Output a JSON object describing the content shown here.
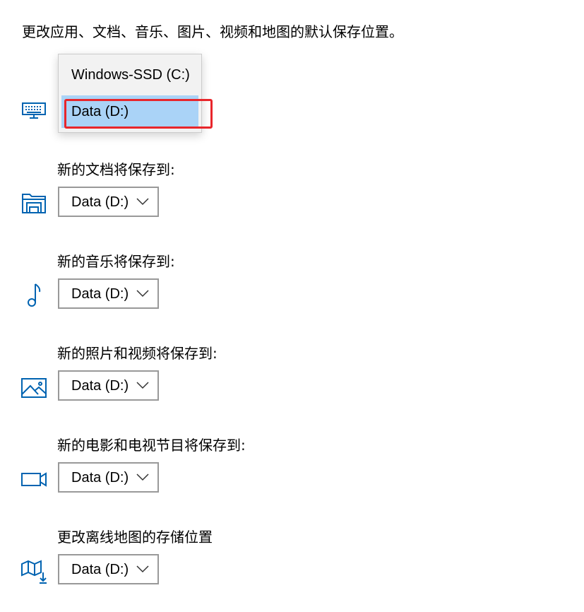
{
  "heading": "更改应用、文档、音乐、图片、视频和地图的默认保存位置。",
  "apps": {
    "icon": "keyboard-monitor-icon",
    "dropdown_options": [
      "Windows-SSD (C:)",
      "Data (D:)"
    ],
    "selected": "Data (D:)"
  },
  "documents": {
    "label": "新的文档将保存到:",
    "icon": "folder-drive-icon",
    "value": "Data (D:)"
  },
  "music": {
    "label": "新的音乐将保存到:",
    "icon": "music-note-icon",
    "value": "Data (D:)"
  },
  "photos": {
    "label": "新的照片和视频将保存到:",
    "icon": "picture-icon",
    "value": "Data (D:)"
  },
  "movies": {
    "label": "新的电影和电视节目将保存到:",
    "icon": "video-camera-icon",
    "value": "Data (D:)"
  },
  "maps": {
    "label": "更改离线地图的存储位置",
    "icon": "map-download-icon",
    "value": "Data (D:)"
  },
  "colors": {
    "icon_blue": "#0063b1",
    "selection_blue": "#aad3f7",
    "highlight_red": "#e8262b",
    "border_gray": "#999999"
  }
}
